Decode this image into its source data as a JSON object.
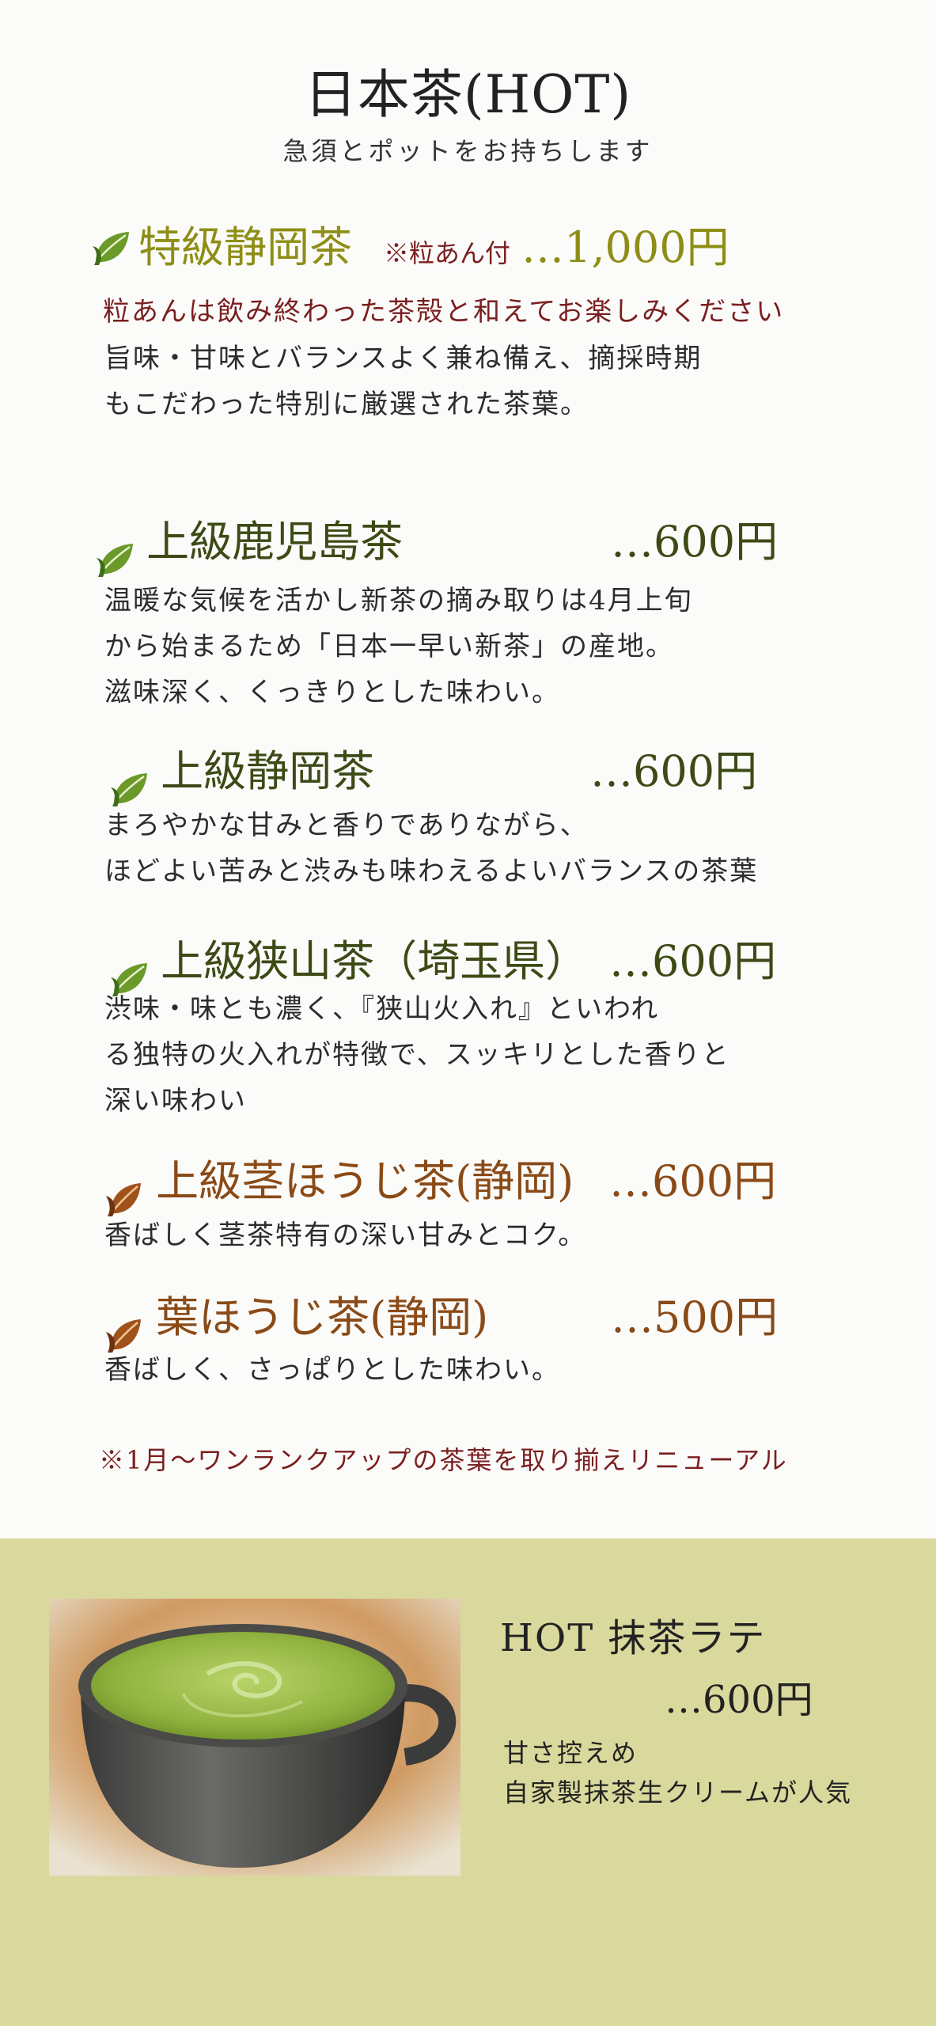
{
  "header": {
    "title": "日本茶(HOT)",
    "subtitle": "急須とポットをお持ちします"
  },
  "items": [
    {
      "icon": "green-tea-leaf-icon",
      "name": "特級静岡茶",
      "note": "※粒あん付",
      "price": "…1,000円",
      "sub_note": "粒あんは飲み終わった茶殻と和えてお楽しみください",
      "desc": [
        "旨味・甘味とバランスよく兼ね備え、摘採時期",
        "もこだわった特別に厳選された茶葉。"
      ]
    },
    {
      "icon": "green-tea-leaf-icon",
      "name": "上級鹿児島茶",
      "price": "…600円",
      "desc": [
        "温暖な気候を活かし新茶の摘み取りは4月上旬",
        "から始まるため「日本一早い新茶」の産地。",
        "滋味深く、くっきりとした味わい。"
      ]
    },
    {
      "icon": "green-tea-leaf-icon",
      "name": "上級静岡茶",
      "price": "…600円",
      "desc": [
        "まろやかな甘みと香りでありながら、",
        "ほどよい苦みと渋みも味わえるよいバランスの茶葉"
      ]
    },
    {
      "icon": "green-tea-leaf-icon",
      "name": "上級狭山茶（埼玉県）",
      "price": "…600円",
      "desc": [
        "渋味・味とも濃く、『狭山火入れ』といわれ",
        "る独特の火入れが特徴で、スッキリとした香りと",
        "深い味わい"
      ]
    },
    {
      "icon": "roasted-leaf-icon",
      "name": "上級茎ほうじ茶(静岡)",
      "price": "…600円",
      "desc": [
        "香ばしく茎茶特有の深い甘みとコク。"
      ]
    },
    {
      "icon": "roasted-leaf-icon",
      "name": "葉ほうじ茶(静岡)",
      "price": "…500円",
      "desc": [
        "香ばしく、さっぱりとした味わい。"
      ]
    }
  ],
  "footnote": "※1月〜ワンランクアップの茶葉を取り揃えリニューアル",
  "latte": {
    "name": "HOT 抹茶ラテ",
    "price": "…600円",
    "desc": "甘さ控えめ\n自家製抹茶生クリームが人気"
  },
  "colors": {
    "olive": "#8e8e16",
    "dark_green": "#3d4a16",
    "brown": "#8a4a16",
    "red": "#7a1f1f",
    "panel": "#d9d99d"
  }
}
